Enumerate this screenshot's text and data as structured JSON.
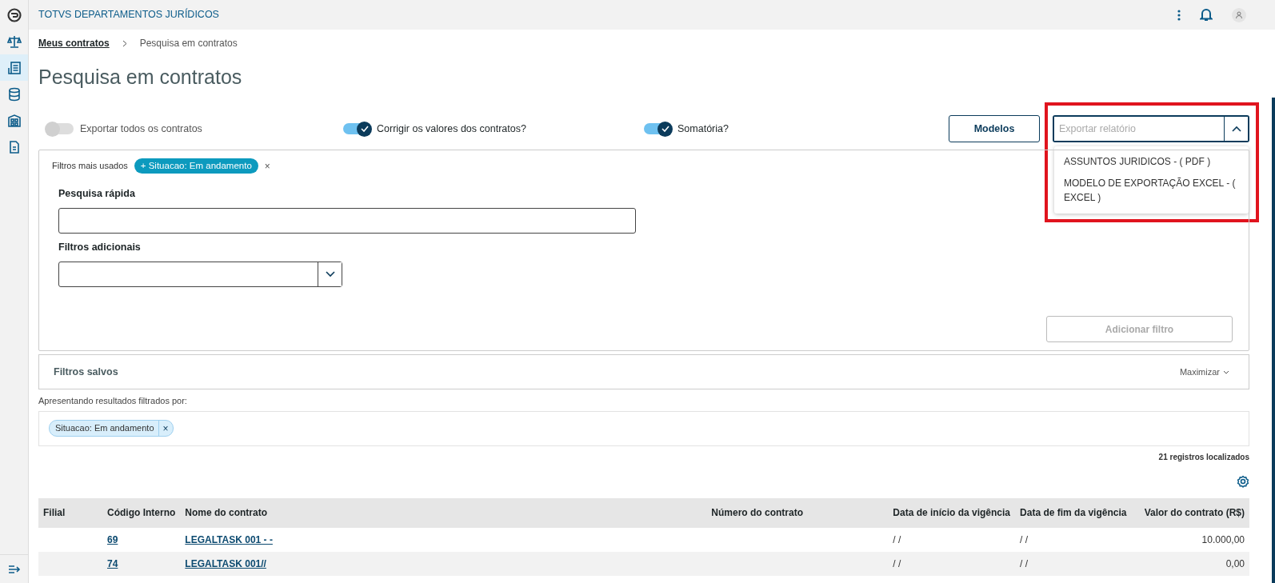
{
  "app": {
    "title": "TOTVS DEPARTAMENTOS JURÍDICOS"
  },
  "sidebar": {
    "items": [
      {
        "selected": false
      },
      {
        "selected": false
      },
      {
        "selected": true
      },
      {
        "selected": false
      },
      {
        "selected": false
      },
      {
        "selected": false
      }
    ]
  },
  "breadcrumb": [
    {
      "label": "Meus contratos"
    },
    {
      "label": "Pesquisa em contratos"
    }
  ],
  "page_title": "Pesquisa em contratos",
  "toggles": [
    {
      "label": "Exportar todos os contratos",
      "on": false
    },
    {
      "label": "Corrigir os valores dos contratos?",
      "on": true
    },
    {
      "label": "Somatória?",
      "on": true
    }
  ],
  "models_button": "Modelos",
  "export_select": {
    "placeholder": "Exportar relatório",
    "expanded": true,
    "highlighted": true,
    "options": [
      "ASSUNTOS JURIDICOS - ( PDF )",
      "MODELO DE EXPORTAÇÃO EXCEL - ( EXCEL )"
    ]
  },
  "filters": {
    "most_used_label": "Filtros mais usados",
    "most_used": [
      {
        "label": "+ Situacao: Em andamento",
        "close": "×"
      }
    ],
    "quick_search_label": "Pesquisa rápida",
    "additional_label": "Filtros adicionais",
    "add_button": {
      "label": "Adicionar filtro",
      "disabled": true
    }
  },
  "saved_filters": {
    "title": "Filtros salvos",
    "toggle": "Maximizar"
  },
  "applied": {
    "label": "Apresentando resultados filtrados por:",
    "chips": [
      {
        "label": "Situacao: Em andamento",
        "close": "×"
      }
    ]
  },
  "results_count": "21 registros localizados",
  "table": {
    "columns": [
      "Filial",
      "Código Interno",
      "Nome do contrato",
      "Número do contrato",
      "Data de início da vigência",
      "Data de fim da vigência",
      "Valor do contrato (R$)"
    ],
    "rows": [
      [
        "",
        "69",
        "LEGALTASK 001 - -",
        "",
        "/ /",
        "/ /",
        "10.000,00"
      ],
      [
        "",
        "74",
        "LEGALTASK 001//",
        "",
        "/ /",
        "/ /",
        "0,00"
      ]
    ]
  }
}
